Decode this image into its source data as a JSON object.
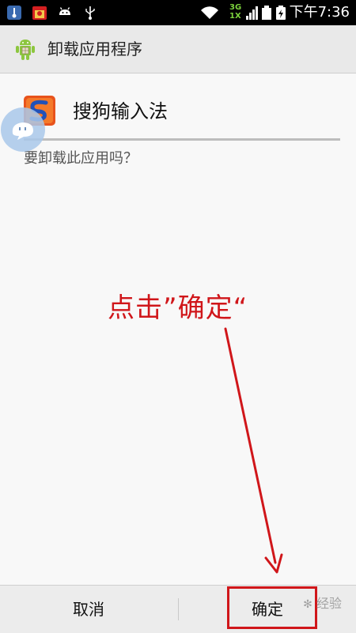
{
  "status_bar": {
    "time": "下午7:36",
    "network_label_top": "3G",
    "network_label_bottom": "1X",
    "icons": [
      "thermometer-icon",
      "calendar-app-icon",
      "android-icon",
      "usb-icon",
      "wifi-icon",
      "signal-icon",
      "sim-icon",
      "battery-icon"
    ]
  },
  "action_bar": {
    "title": "卸载应用程序",
    "icon": "android-robot-icon"
  },
  "dialog": {
    "app_name": "搜狗输入法",
    "question": "要卸载此应用吗？"
  },
  "buttons": {
    "cancel": "取消",
    "ok": "确定"
  },
  "annotation": {
    "text": "点击”确定“",
    "color": "#d0161a"
  },
  "watermark": {
    "text": "经验"
  },
  "colors": {
    "status_bar": "#000000",
    "action_bar": "#e9e9e9",
    "background": "#f8f8f8",
    "annotation_red": "#d0161a",
    "android_green": "#8cc63e",
    "sogou_orange": "#e8531c"
  }
}
